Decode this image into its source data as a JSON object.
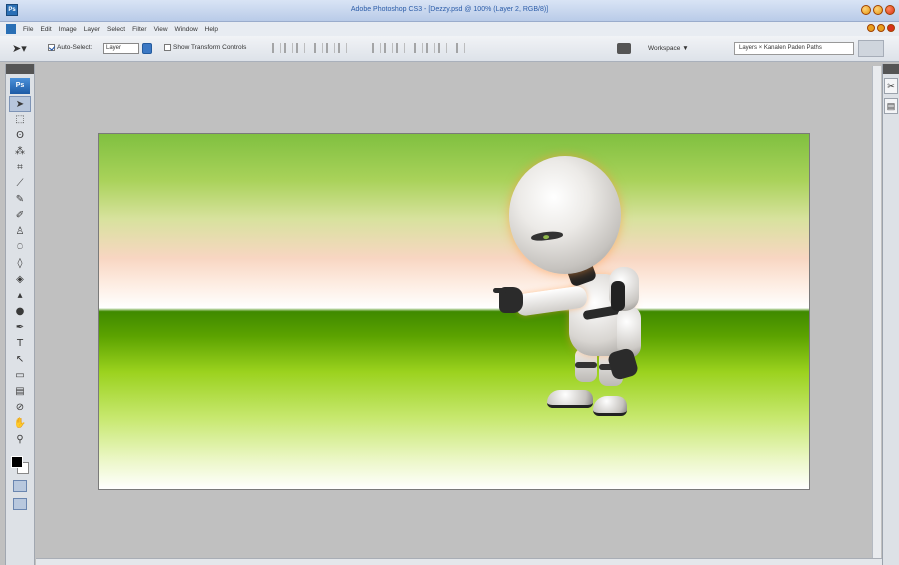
{
  "window": {
    "title": "Adobe Photoshop CS3 - [Dezzy.psd @ 100% (Layer 2, RGB/8)]",
    "app_badge": "Ps"
  },
  "menu": {
    "items": [
      "File",
      "Edit",
      "Image",
      "Layer",
      "Select",
      "Filter",
      "View",
      "Window",
      "Help"
    ]
  },
  "options": {
    "auto_select_label": "Auto-Select:",
    "auto_select_checked": true,
    "auto_select_value": "Layer",
    "show_transform_label": "Show Transform Controls",
    "show_transform_checked": false,
    "workspace_label": "Workspace ▼",
    "dock_tabs": "Layers × Kanalen  Paden  Paths"
  },
  "tools": {
    "logo": "Ps",
    "icons": [
      "move-icon",
      "marquee-icon",
      "lasso-icon",
      "magic-wand-icon",
      "crop-icon",
      "slice-icon",
      "healing-brush-icon",
      "brush-icon",
      "clone-stamp-icon",
      "history-brush-icon",
      "eraser-icon",
      "paint-bucket-icon",
      "blur-icon",
      "dodge-icon",
      "pen-icon",
      "type-icon",
      "path-selection-icon",
      "shape-icon",
      "notes-icon",
      "eyedropper-icon",
      "hand-icon",
      "zoom-icon"
    ],
    "glyphs": [
      "➤",
      "⬚",
      "ʘ",
      "⁂",
      "⌗",
      "⟋",
      "✎",
      "✐",
      "♙",
      "⍥",
      "◊",
      "◈",
      "▴",
      "●",
      "✒",
      "T",
      "↖",
      "▭",
      "▤",
      "⊘",
      "✋",
      "⚲"
    ]
  },
  "colors": {
    "foreground": "#000000",
    "background": "#ffffff"
  }
}
